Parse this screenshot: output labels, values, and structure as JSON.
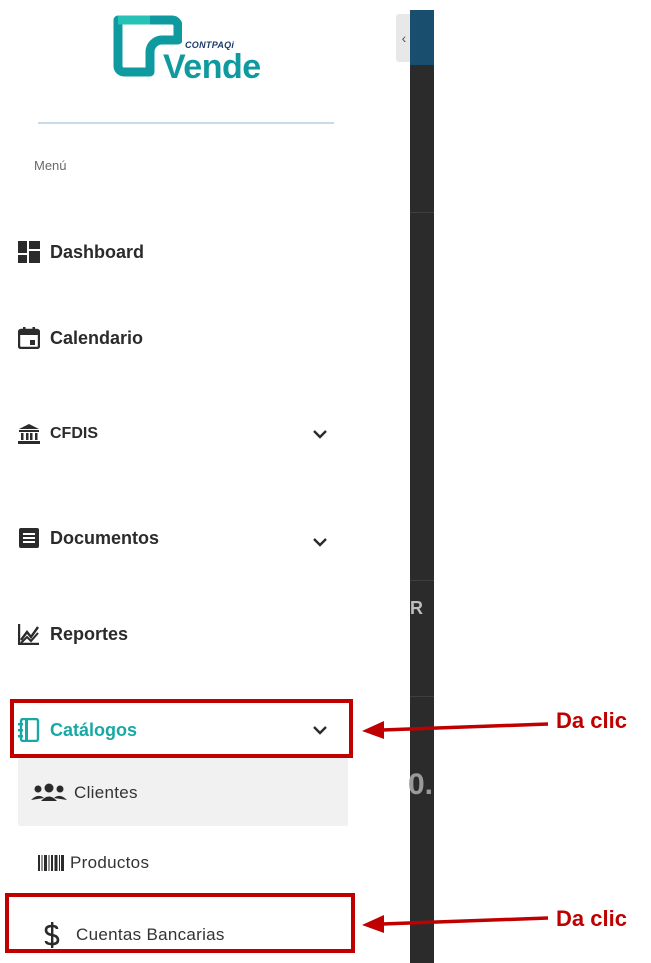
{
  "logo": {
    "brand_small": "CONTPAQi",
    "brand_big": "Vende"
  },
  "menu_label": "Menú",
  "nav": {
    "dashboard": "Dashboard",
    "calendario": "Calendario",
    "cfdis": "CFDIS",
    "documentos": "Documentos",
    "reportes": "Reportes",
    "catalogos": "Catálogos"
  },
  "submenu": {
    "clientes": "Clientes",
    "productos": "Productos",
    "cuentas": "Cuentas Bancarias"
  },
  "background": {
    "fragment_r": "R",
    "fragment_num": "0."
  },
  "annotations": {
    "callout_1": "Da clic",
    "callout_2": "Da clic"
  },
  "colors": {
    "accent": "#18a9a6",
    "annotation": "#c00000",
    "dark_panel": "#2b2b2b"
  },
  "collapse_icon": "‹"
}
